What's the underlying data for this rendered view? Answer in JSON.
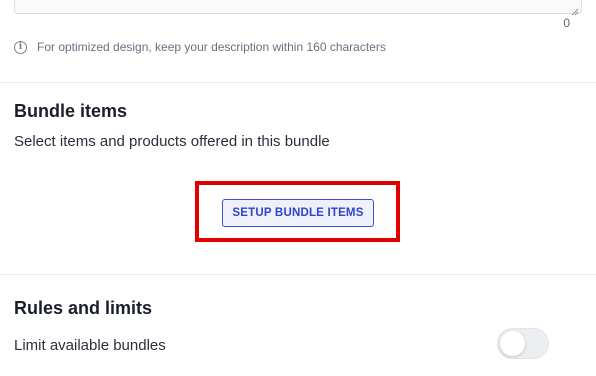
{
  "description_field": {
    "char_count": "0"
  },
  "hint": {
    "icon": "info-icon",
    "text": "For optimized design, keep your description within 160 characters"
  },
  "bundle_items": {
    "title": "Bundle items",
    "description": "Select items and products offered in this bundle",
    "setup_button_label": "SETUP BUNDLE ITEMS",
    "highlight_color": "#e00000"
  },
  "rules_and_limits": {
    "title": "Rules and limits",
    "limit_label": "Limit available bundles",
    "limit_enabled": false
  },
  "colors": {
    "accent": "#2f44c9"
  }
}
